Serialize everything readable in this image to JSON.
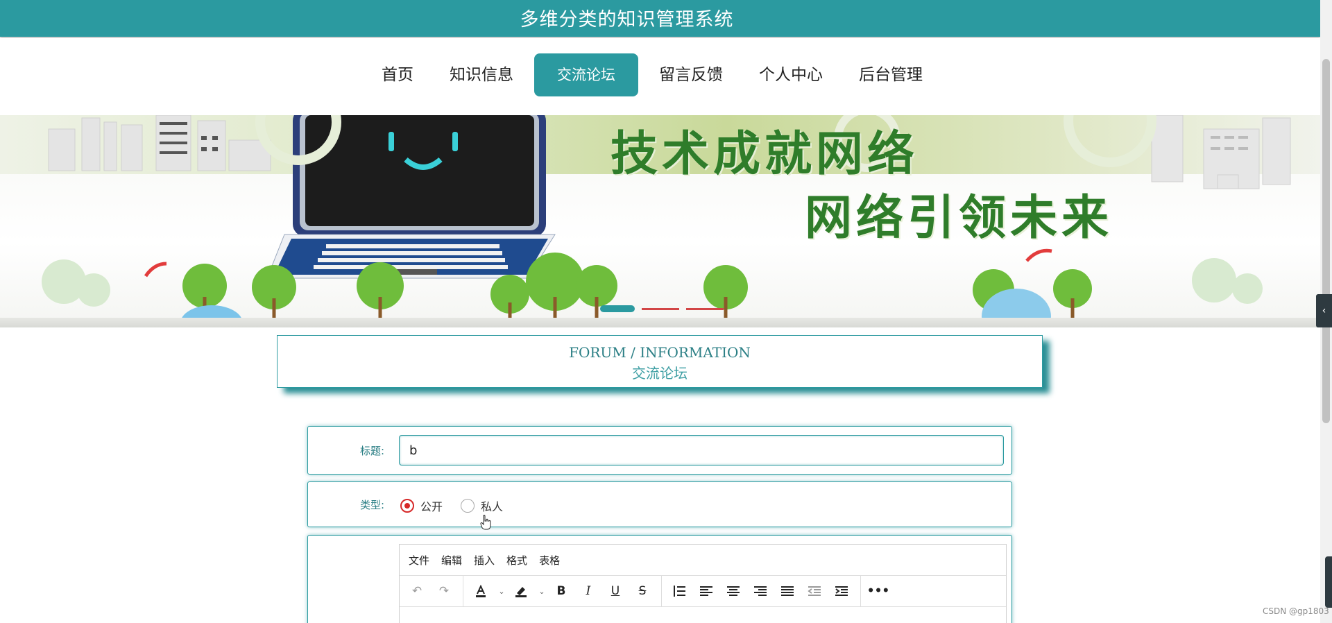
{
  "header": {
    "title": "多维分类的知识管理系统"
  },
  "nav": {
    "items": [
      {
        "label": "首页"
      },
      {
        "label": "知识信息"
      },
      {
        "label": "交流论坛",
        "active": true
      },
      {
        "label": "留言反馈"
      },
      {
        "label": "个人中心"
      },
      {
        "label": "后台管理"
      }
    ]
  },
  "banner": {
    "slogan_line1": "技术成就网络",
    "slogan_line2": "网络引领未来",
    "slide_count": 3,
    "active_slide": 1
  },
  "section": {
    "title_en": "FORUM / INFORMATION",
    "title_zh": "交流论坛"
  },
  "form": {
    "title_label": "标题:",
    "title_value": "b",
    "type_label": "类型:",
    "type_options": [
      {
        "label": "公开",
        "checked": true
      },
      {
        "label": "私人",
        "checked": false
      }
    ]
  },
  "editor": {
    "menu": [
      "文件",
      "编辑",
      "插入",
      "格式",
      "表格"
    ],
    "toolbar_icons": [
      "undo-icon",
      "redo-icon",
      "text-color-icon",
      "highlight-icon",
      "bold-icon",
      "italic-icon",
      "underline-icon",
      "strikethrough-icon",
      "line-height-icon",
      "align-left-icon",
      "align-center-icon",
      "align-right-icon",
      "justify-icon",
      "outdent-icon",
      "indent-icon",
      "more-icon"
    ]
  },
  "watermark": "CSDN @gp1803",
  "colors": {
    "primary": "#2b9aa0",
    "radio_checked": "#d62828",
    "slogan_green": "#2f7d2a"
  }
}
